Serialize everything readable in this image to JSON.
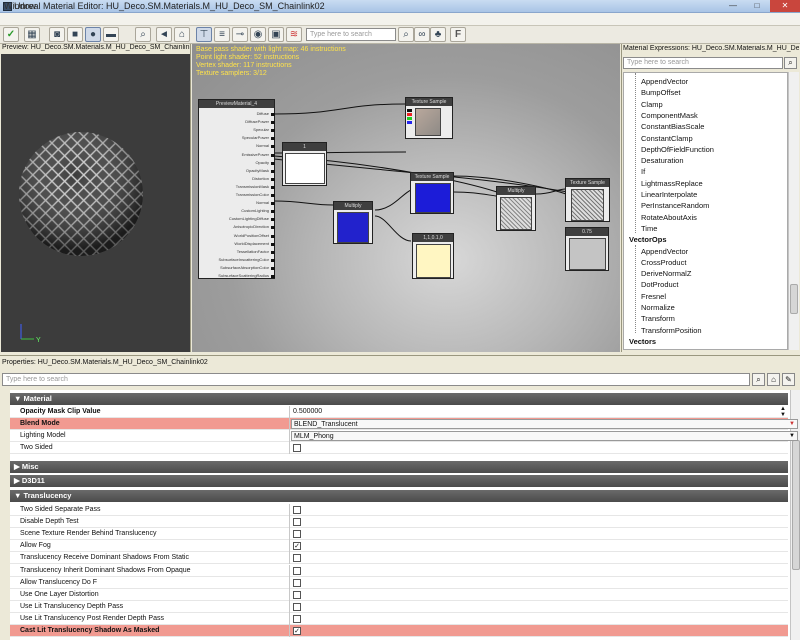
{
  "window": {
    "title": "Unreal Material Editor: HU_Deco.SM.Materials.M_HU_Deco_SM_Chainlink02",
    "minimize_glyph": "—",
    "maximize_glyph": "□",
    "close_glyph": "✕"
  },
  "menu": {
    "window_label": "Window"
  },
  "toolbar": {
    "search_placeholder": "Type here to search",
    "icons": [
      "check-icon",
      "grid-icon",
      "cylinder-icon",
      "cube-icon",
      "sphere-icon",
      "plane-icon",
      "search-icon",
      "back-icon",
      "home-icon",
      "node-icon",
      "stat-icon",
      "connector-icon",
      "eye-icon",
      "realtime-icon",
      "mobile-icon",
      "search-icon",
      "binoculars-icon",
      "clean-icon",
      "f-icon"
    ]
  },
  "preview": {
    "header": "Preview: HU_Deco.SM.Materials.M_HU_Deco_SM_Chainlink02",
    "axis_y": "Y"
  },
  "graph": {
    "stats": [
      "Base pass shader with light map: 46 instructions",
      "Point light shader: 52 instructions",
      "Vertex shader: 117 instructions",
      "Texture samplers: 3/12"
    ],
    "material_node": {
      "title": "PreviewMaterial_4",
      "inputs": [
        "Diffuse",
        "DiffusePower",
        "Specular",
        "SpecularPower",
        "Normal",
        "EmissivePower",
        "Opacity",
        "OpacityMask",
        "Distortion",
        "TransmissionMask",
        "TransmissionColor",
        "Normal",
        "CustomLighting",
        "CustomLightingDiffuse",
        "AnisotropicDirection",
        "WorldPositionOffset",
        "WorldDisplacement",
        "TessellationFactor",
        "SubsurfaceInscatteringColor",
        "SubsurfaceAbsorptionColor",
        "SubsurfaceScatteringRadius"
      ]
    },
    "nodes": {
      "tex_top": "Texture Sample",
      "const_white": "1",
      "multiply_left": "Multiply",
      "tex_mid": "Texture Sample",
      "multiply_right": "Multiply",
      "tex_right": "Texture Sample",
      "const_vector": "1,1,0.1,0",
      "scalar": "0.75"
    }
  },
  "expressions": {
    "header": "Material Expressions: HU_Deco.SM.Materials.M_HU_Deco_SM_Chainlink02",
    "search_placeholder": "Type here to search",
    "items": [
      {
        "label": "AppendVector",
        "cat": false
      },
      {
        "label": "BumpOffset",
        "cat": false
      },
      {
        "label": "Clamp",
        "cat": false
      },
      {
        "label": "ComponentMask",
        "cat": false
      },
      {
        "label": "ConstantBiasScale",
        "cat": false
      },
      {
        "label": "ConstantClamp",
        "cat": false
      },
      {
        "label": "DepthOfFieldFunction",
        "cat": false
      },
      {
        "label": "Desaturation",
        "cat": false
      },
      {
        "label": "If",
        "cat": false
      },
      {
        "label": "LightmassReplace",
        "cat": false
      },
      {
        "label": "LinearInterpolate",
        "cat": false
      },
      {
        "label": "PerInstanceRandom",
        "cat": false
      },
      {
        "label": "RotateAboutAxis",
        "cat": false
      },
      {
        "label": "Time",
        "cat": false
      },
      {
        "label": "VectorOps",
        "cat": true
      },
      {
        "label": "AppendVector",
        "cat": false
      },
      {
        "label": "CrossProduct",
        "cat": false
      },
      {
        "label": "DeriveNormalZ",
        "cat": false
      },
      {
        "label": "DotProduct",
        "cat": false
      },
      {
        "label": "Fresnel",
        "cat": false
      },
      {
        "label": "Normalize",
        "cat": false
      },
      {
        "label": "Transform",
        "cat": false
      },
      {
        "label": "TransformPosition",
        "cat": false
      },
      {
        "label": "Vectors",
        "cat": true
      }
    ]
  },
  "properties": {
    "header": "Properties: HU_Deco.SM.Materials.M_HU_Deco_SM_Chainlink02",
    "search_placeholder": "Type here to search",
    "sections": {
      "material": "Material",
      "misc": "Misc",
      "d3d11": "D3D11",
      "translucency": "Translucency"
    },
    "material_rows": {
      "opacity_mask_clip_label": "Opacity Mask Clip Value",
      "opacity_mask_clip_value": "0.500000",
      "blend_mode_label": "Blend Mode",
      "blend_mode_value": "BLEND_Translucent",
      "lighting_model_label": "Lighting Model",
      "lighting_model_value": "MLM_Phong",
      "two_sided_label": "Two Sided"
    },
    "translucency_rows": [
      {
        "label": "Two Sided Separate Pass",
        "checked": false
      },
      {
        "label": "Disable Depth Test",
        "checked": false
      },
      {
        "label": "Scene Texture Render Behind Translucency",
        "checked": false
      },
      {
        "label": "Allow Fog",
        "checked": true
      },
      {
        "label": "Translucency Receive Dominant Shadows From Static",
        "checked": false
      },
      {
        "label": "Translucency Inherit Dominant Shadows From Opaque",
        "checked": false
      },
      {
        "label": "Allow Translucency Do F",
        "checked": false
      },
      {
        "label": "Use One Layer Distortion",
        "checked": false
      },
      {
        "label": "Use Lit Translucency Depth Pass",
        "checked": false
      },
      {
        "label": "Use Lit Translucency Post Render Depth Pass",
        "checked": false
      },
      {
        "label": "Cast Lit Translucency Shadow As Masked",
        "checked": true
      }
    ],
    "check_glyph": "✓",
    "collapsed_glyph": "▶",
    "expanded_glyph": "▼"
  }
}
